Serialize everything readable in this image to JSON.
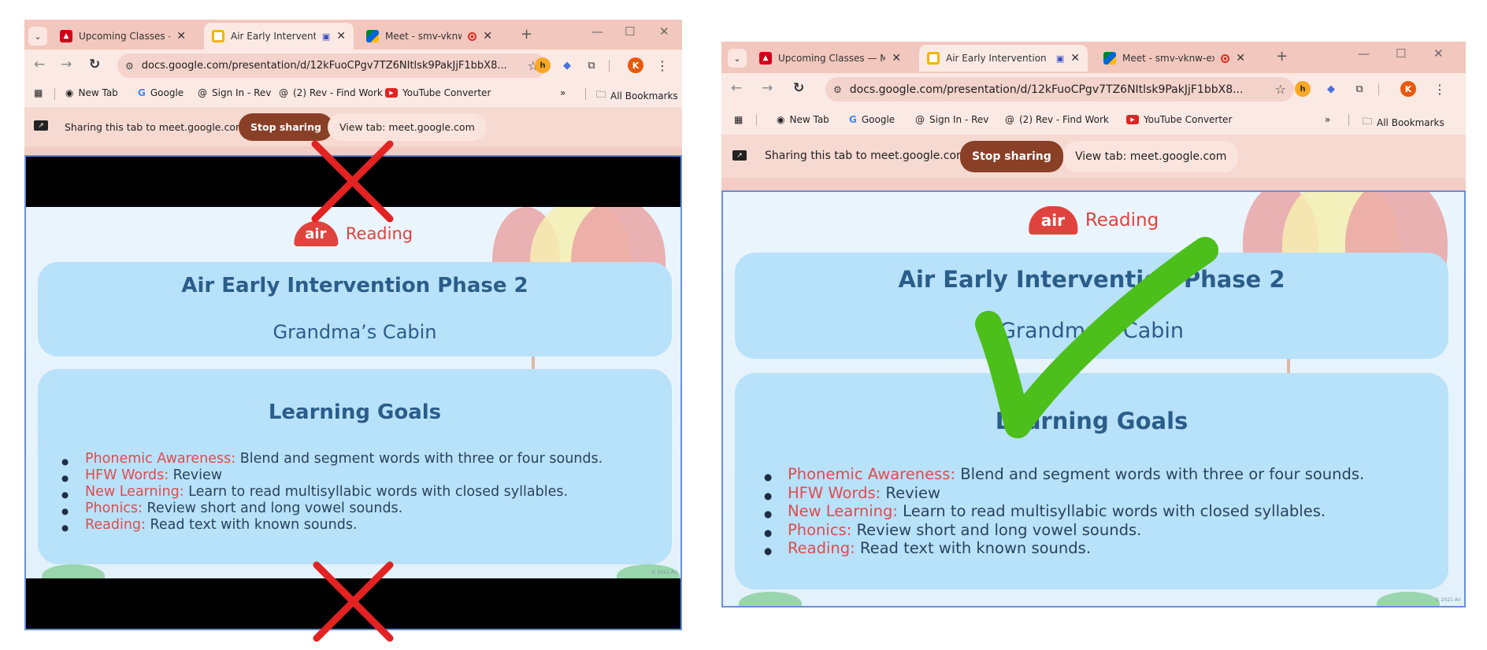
{
  "browser": {
    "tabs": [
      {
        "label": "Upcoming Classes — My",
        "icon": "mb-logo-icon"
      },
      {
        "label": "Air Early Intervention",
        "icon": "slides-icon",
        "active": true
      },
      {
        "label": "Meet - smv-vknw-ex",
        "icon": "meet-icon"
      }
    ],
    "url": "docs.google.com/presentation/d/12kFuoCPgv7TZ6NItlsk9PakJjF1bbX8...",
    "bookmarks": [
      "New Tab",
      "Google",
      "Sign In - Rev",
      "(2) Rev - Find Work",
      "YouTube Converter"
    ],
    "bookmarks_more": "»",
    "all_bookmarks": "All Bookmarks",
    "avatar_letter": "K"
  },
  "share_bar": {
    "text": "Sharing this tab to meet.google.com",
    "stop_label": "Stop sharing",
    "view_label": "View tab: meet.google.com"
  },
  "slide": {
    "logo_mark": "air",
    "logo_text": "Reading",
    "title": "Air Early Intervention Phase 2",
    "subtitle": "Grandma’s Cabin",
    "goals_title": "Learning Goals",
    "goals": [
      {
        "key": "Phonemic Awareness:",
        "text": " Blend and segment words with three or four sounds."
      },
      {
        "key": "HFW Words:",
        "text": " Review"
      },
      {
        "key": "New Learning:",
        "text": " Learn to read multisyllabic words with closed syllables."
      },
      {
        "key": "Phonics:",
        "text": " Review short and long vowel sounds."
      },
      {
        "key": "Reading:",
        "text": " Read text with known sounds."
      }
    ],
    "copyright": "© 2021 Air"
  },
  "colors": {
    "cross": "#e32222",
    "check": "#4cbf1a",
    "stop_button": "#8a3f27",
    "frame": "#f2c7bd"
  }
}
